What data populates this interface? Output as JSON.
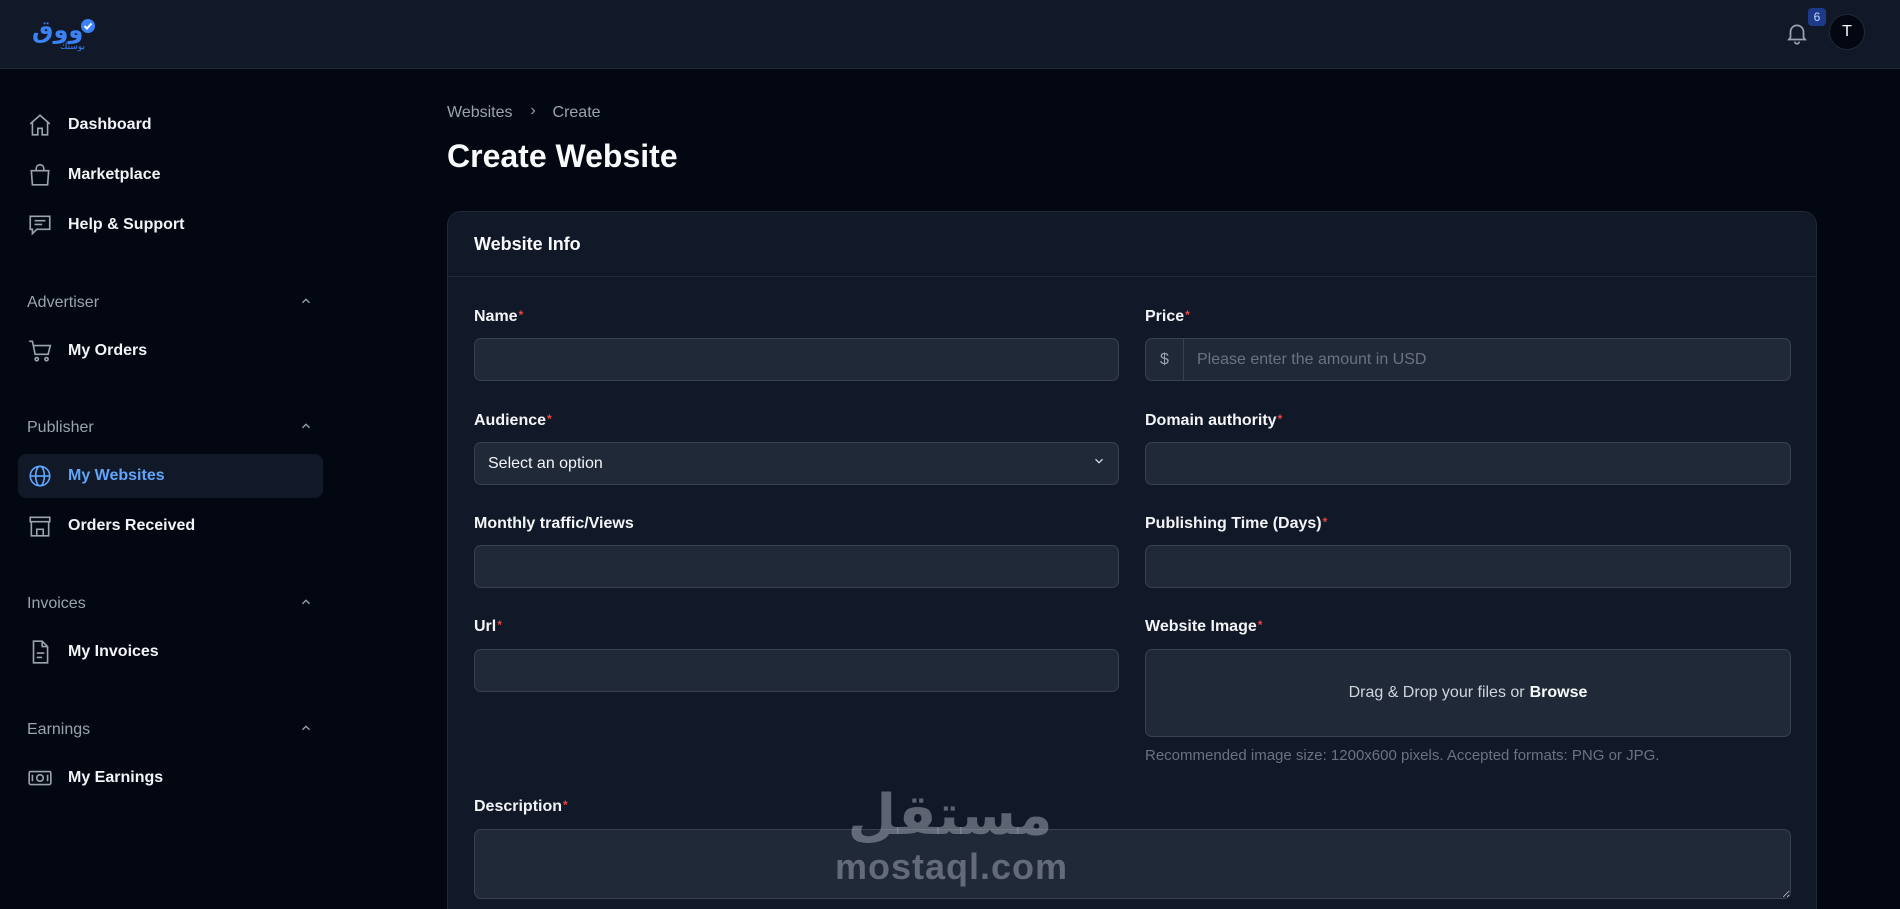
{
  "header": {
    "logo_text": "بوستك",
    "notifications_count": "6",
    "avatar_initial": "T"
  },
  "sidebar": {
    "items_top": [
      {
        "label": "Dashboard",
        "icon": "home-icon"
      },
      {
        "label": "Marketplace",
        "icon": "shopping-bag-icon"
      },
      {
        "label": "Help & Support",
        "icon": "chat-icon"
      }
    ],
    "sections": [
      {
        "title": "Advertiser",
        "items": [
          {
            "label": "My Orders",
            "icon": "cart-icon"
          }
        ]
      },
      {
        "title": "Publisher",
        "items": [
          {
            "label": "My Websites",
            "icon": "globe-icon",
            "active": true
          },
          {
            "label": "Orders Received",
            "icon": "store-icon"
          }
        ]
      },
      {
        "title": "Invoices",
        "items": [
          {
            "label": "My Invoices",
            "icon": "document-icon"
          }
        ]
      },
      {
        "title": "Earnings",
        "items": [
          {
            "label": "My Earnings",
            "icon": "cash-icon"
          }
        ]
      }
    ]
  },
  "breadcrumb": {
    "parent": "Websites",
    "current": "Create"
  },
  "page_title": "Create Website",
  "form": {
    "card_title": "Website Info",
    "name": {
      "label": "Name",
      "value": ""
    },
    "price": {
      "label": "Price",
      "prefix": "$",
      "placeholder": "Please enter the amount in USD"
    },
    "audience": {
      "label": "Audience",
      "selected": "Select an option"
    },
    "domain_authority": {
      "label": "Domain authority",
      "value": ""
    },
    "monthly_traffic": {
      "label": "Monthly traffic/Views",
      "value": ""
    },
    "publishing_time": {
      "label": "Publishing Time (Days)",
      "value": ""
    },
    "url": {
      "label": "Url",
      "value": ""
    },
    "website_image": {
      "label": "Website Image",
      "drop_text": "Drag & Drop your files or",
      "browse_text": "Browse",
      "hint": "Recommended image size: 1200x600 pixels. Accepted formats: PNG or JPG."
    },
    "description": {
      "label": "Description",
      "value": ""
    },
    "required_mark": "*"
  },
  "watermark": {
    "arabic": "مستقل",
    "latin": "mostaql.com"
  },
  "colors": {
    "accent": "#60a5fa",
    "background": "#030712",
    "panel": "#111827",
    "required": "#ef4444"
  }
}
